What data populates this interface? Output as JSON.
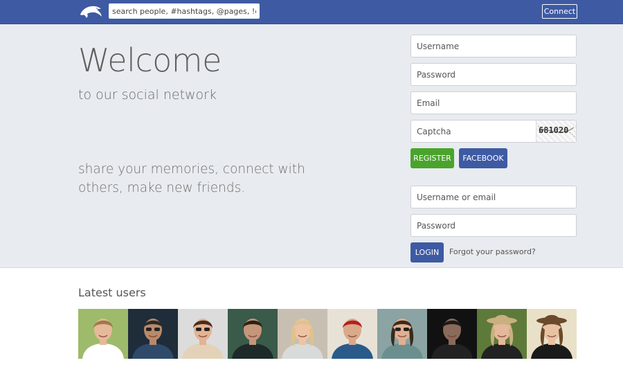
{
  "header": {
    "search_placeholder": "search people, #hashtags, @pages, !groups",
    "connect_label": "Connect"
  },
  "hero": {
    "title": "Welcome",
    "subtitle": "to our social network",
    "tagline": "share your memories, connect with others, make new friends."
  },
  "register_form": {
    "username_placeholder": "Username",
    "password_placeholder": "Password",
    "email_placeholder": "Email",
    "captcha_placeholder": "Captcha",
    "captcha_code": "681020",
    "register_label": "REGISTER",
    "facebook_label": "FACEBOOK"
  },
  "login_form": {
    "username_placeholder": "Username or email",
    "password_placeholder": "Password",
    "login_label": "LOGIN",
    "forgot_label": "Forgot your password?"
  },
  "latest_users": {
    "title": "Latest users",
    "users": [
      {
        "bg": "#9dbb6a",
        "skin": "#e6b99a",
        "hair": "#a07a48",
        "shirt": "#ffffff"
      },
      {
        "bg": "#1f2d3a",
        "skin": "#b88a6a",
        "hair": "#2a2a2a",
        "shirt": "#2f4a6a"
      },
      {
        "bg": "#dcdcdc",
        "skin": "#e2b394",
        "hair": "#4a2c1a",
        "shirt": "#e3d2b8"
      },
      {
        "bg": "#3a5a4a",
        "skin": "#c4967a",
        "hair": "#2b2218",
        "shirt": "#1e2a2a"
      },
      {
        "bg": "#c7c0b2",
        "skin": "#ecc4a4",
        "hair": "#e0c28a",
        "shirt": "#d9dada"
      },
      {
        "bg": "#e8e2d6",
        "skin": "#d9a98a",
        "hair": "#b52020",
        "shirt": "#2a5a8a"
      },
      {
        "bg": "#8ba3a3",
        "skin": "#e1b092",
        "hair": "#3a2a1e",
        "shirt": "#6b8f8f"
      },
      {
        "bg": "#111111",
        "skin": "#8a6a5a",
        "hair": "#1c1c1c",
        "shirt": "#222222"
      },
      {
        "bg": "#5e7a3a",
        "skin": "#e4b89a",
        "hair": "#c9b080",
        "shirt": "#222222"
      },
      {
        "bg": "#e9e0c8",
        "skin": "#e8c2a2",
        "hair": "#6a4a2a",
        "shirt": "#1a1a1a"
      }
    ]
  },
  "colors": {
    "header_bg": "#3e5aa3",
    "hero_bg": "#e8ebef",
    "register_green": "#4aa42c",
    "primary_blue": "#3e5aa3"
  },
  "icons": {
    "logo": "dolphin-icon"
  }
}
